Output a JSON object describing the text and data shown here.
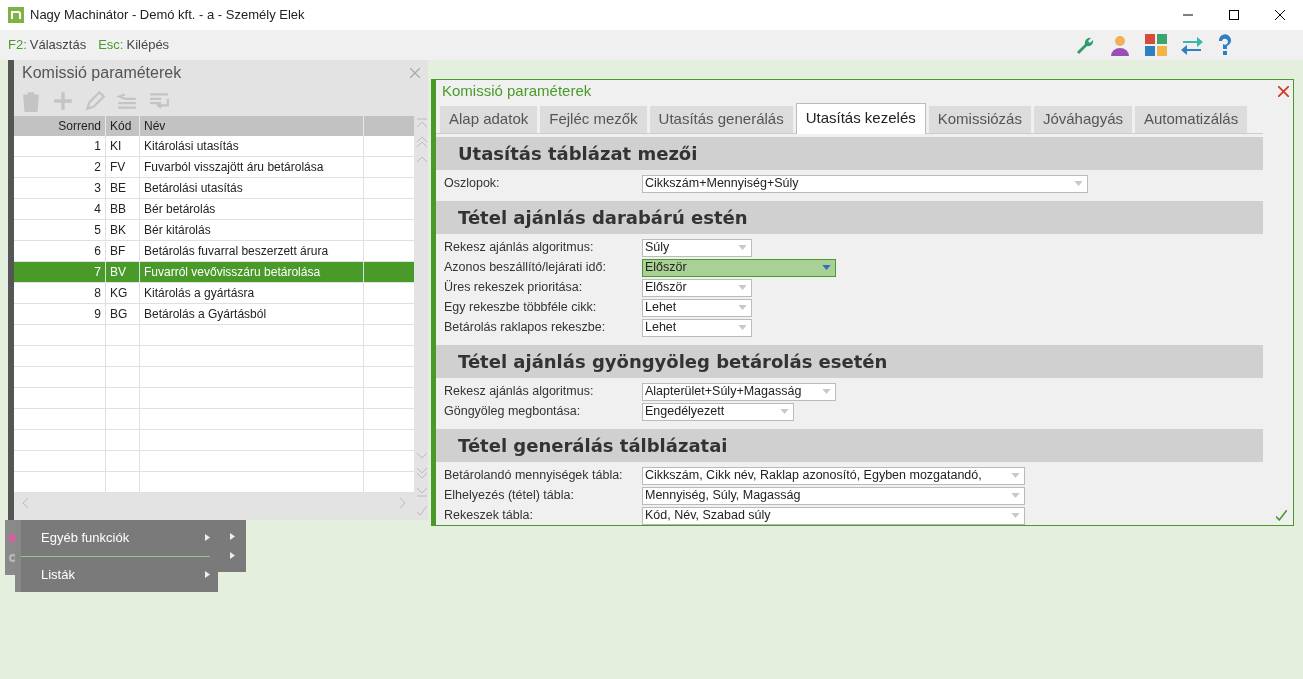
{
  "window": {
    "title": "Nagy Machinátor - Demó kft. - a - Személy Elek"
  },
  "shortcuts": [
    {
      "key": "F2:",
      "label": "Választás"
    },
    {
      "key": "Esc:",
      "label": "Kilépés"
    }
  ],
  "list_panel": {
    "title": "Komissió paraméterek",
    "toolbar": [
      {
        "kind": "delete"
      },
      {
        "kind": "add"
      },
      {
        "kind": "edit"
      },
      {
        "kind": "move-up"
      },
      {
        "kind": "move-down"
      }
    ],
    "columns": [
      "Sorrend",
      "Kód",
      "Név"
    ],
    "rows": [
      {
        "order": "1",
        "code": "KI",
        "name": "Kitárolási utasítás",
        "selected": false
      },
      {
        "order": "2",
        "code": "FV",
        "name": "Fuvarból visszajött áru betárolása",
        "selected": false
      },
      {
        "order": "3",
        "code": "BE",
        "name": "Betárolási utasítás",
        "selected": false
      },
      {
        "order": "4",
        "code": "BB",
        "name": "Bér betárolás",
        "selected": false
      },
      {
        "order": "5",
        "code": "BK",
        "name": "Bér kitárolás",
        "selected": false
      },
      {
        "order": "6",
        "code": "BF",
        "name": "Betárolás fuvarral beszerzett árura",
        "selected": false
      },
      {
        "order": "7",
        "code": "BV",
        "name": "Fuvarról vevővisszáru betárolása",
        "selected": true
      },
      {
        "order": "8",
        "code": "KG",
        "name": "Kitárolás a gyártásra",
        "selected": false
      },
      {
        "order": "9",
        "code": "BG",
        "name": "Betárolás a Gyártásból",
        "selected": false
      }
    ]
  },
  "menu": {
    "items": [
      {
        "label": "Egyéb funkciók"
      },
      {
        "label": "Listák"
      }
    ]
  },
  "dialog": {
    "title": "Komissió paraméterek",
    "tabs": [
      {
        "label": "Alap adatok",
        "selected": false
      },
      {
        "label": "Fejléc mezők",
        "selected": false
      },
      {
        "label": "Utasítás generálás",
        "selected": false
      },
      {
        "label": "Utasítás kezelés",
        "selected": true
      },
      {
        "label": "Komissiózás",
        "selected": false
      },
      {
        "label": "Jóváhagyás",
        "selected": false
      },
      {
        "label": "Automatizálás",
        "selected": false
      }
    ],
    "sections": [
      {
        "title": "Utasítás táblázat mezői",
        "fields": [
          {
            "label": "Oszlopok:",
            "value": "Cikkszám+Mennyiség+Súly",
            "focused": false
          }
        ]
      },
      {
        "title": "Tétel ajánlás darabárú estén",
        "fields": [
          {
            "label": "Rekesz ajánlás algoritmus:",
            "value": "Súly",
            "focused": false
          },
          {
            "label": "Azonos beszállító/lejárati idő:",
            "value": "Először",
            "focused": true
          },
          {
            "label": "Üres rekeszek prioritása:",
            "value": "Először",
            "focused": false
          },
          {
            "label": "Egy rekeszbe többféle cikk:",
            "value": "Lehet",
            "focused": false
          },
          {
            "label": "Betárolás raklapos rekeszbe:",
            "value": "Lehet",
            "focused": false
          }
        ]
      },
      {
        "title": "Tétel ajánlás gyöngyöleg betárolás esetén",
        "fields": [
          {
            "label": "Rekesz ajánlás algoritmus:",
            "value": "Alapterület+Súly+Magasság",
            "focused": false
          },
          {
            "label": "Göngyöleg megbontása:",
            "value": "Engedélyezett",
            "focused": false
          }
        ]
      },
      {
        "title": "Tétel generálás tálblázatai",
        "fields": [
          {
            "label": "Betárolandó mennyiségek tábla:",
            "value": "Cikkszám, Cikk név, Raklap azonosító, Egyben mozgatandó,",
            "focused": false
          },
          {
            "label": "Elhelyezés (tétel) tábla:",
            "value": "Mennyiség, Súly, Magasság",
            "focused": false
          },
          {
            "label": "Rekeszek tábla:",
            "value": "Kód, Név, Szabad súly",
            "focused": false
          }
        ]
      }
    ]
  }
}
